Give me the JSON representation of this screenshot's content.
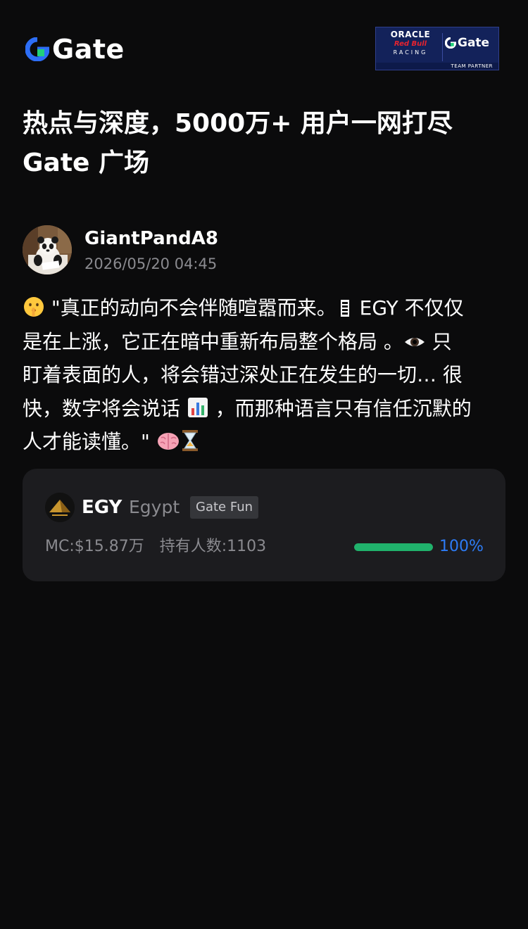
{
  "header": {
    "logo_text": "Gate",
    "partner": {
      "oracle": "ORACLE",
      "redbull": "Red Bull",
      "racing": "RACING",
      "gate": "Gate",
      "footer": "TEAM PARTNER"
    }
  },
  "headline": {
    "line1": "热点与深度，5000万+ 用户一网打尽",
    "line2": "Gate 广场"
  },
  "post": {
    "author": "GiantPandA8",
    "time": "2026/05/20 04:45",
    "lines": [
      {
        "a": " \"真正的动向不会伴随喧嚣而来。",
        "b": " EGY 不仅仅"
      },
      "是在上涨，它正在暗中重新布局整个格局 。",
      {
        "b": " 只"
      },
      "盯着表面的人，将会错过深处正在发生的一切… 很",
      {
        "a": "快，数字将会说话 ",
        "b": " ，而那种语言只有信任沉默的"
      },
      "人才能读懂。\" "
    ],
    "emojis": [
      "shushing-face",
      "coffin-icon",
      "eye",
      "bar-chart",
      "brain",
      "hourglass"
    ]
  },
  "token_card": {
    "symbol": "EGY",
    "name": "Egypt",
    "tag": "Gate Fun",
    "market_cap": "MC:$15.87万",
    "holders": "持有人数:1103",
    "progress_label": "100%",
    "progress": 1.0,
    "colors": {
      "progress": "#20b26c",
      "progress_label": "#2d7cf6"
    }
  }
}
